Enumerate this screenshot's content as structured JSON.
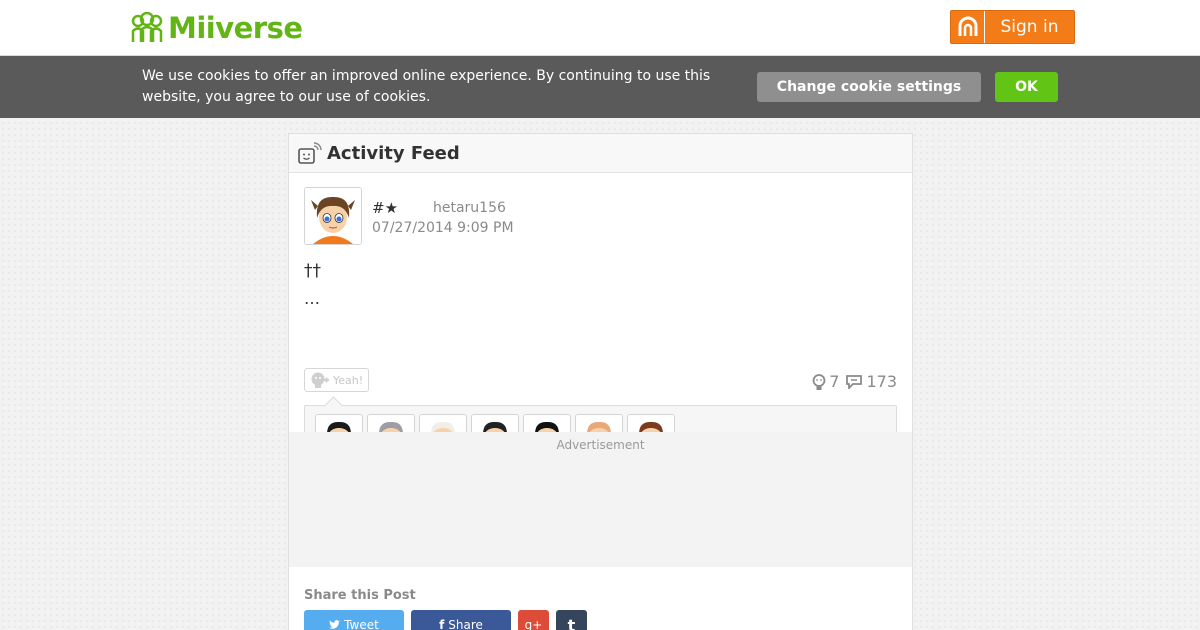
{
  "header": {
    "logo_text": "Miiverse",
    "signin_label": "Sign in"
  },
  "cookie": {
    "message": "We use cookies to offer an improved online experience. By continuing to use this website, you agree to our use of cookies.",
    "settings_label": "Change cookie settings",
    "ok_label": "OK"
  },
  "feed": {
    "title": "Activity Feed"
  },
  "post": {
    "screen_name": "#★",
    "user_id": "hetaru156",
    "timestamp": "07/27/2014 9:09 PM",
    "body_line1": "††",
    "body_line2": "…",
    "yeah_label": "Yeah!",
    "empathy_count": "7",
    "reply_count": "173"
  },
  "yeah_users": [
    {
      "hair": "#1a1a1a",
      "shirt": "#2e9a3f",
      "glasses": "sunglasses"
    },
    {
      "hair": "#9d9da5",
      "shirt": "#303030",
      "glasses": "none"
    },
    {
      "hair": "#f2ede6",
      "shirt": "#2f66c8",
      "glasses": "none"
    },
    {
      "hair": "#222222",
      "shirt": "#2a2a2a",
      "glasses": "glasses"
    },
    {
      "hair": "#111111",
      "shirt": "#d63131",
      "glasses": "red-glasses"
    },
    {
      "hair": "#e8a878",
      "shirt": "#222222",
      "glasses": "sunglasses"
    },
    {
      "hair": "#7a3b1f",
      "shirt": "#e86d9e",
      "glasses": "none"
    }
  ],
  "ad": {
    "label": "Advertisement"
  },
  "share": {
    "title": "Share this Post",
    "tweet_label": "Tweet",
    "facebook_label": "Share"
  },
  "colors": {
    "brand_green": "#62b514",
    "signin_orange": "#f47c18",
    "ok_green": "#62c414",
    "twitter": "#55acee",
    "facebook": "#3b5998",
    "gplus": "#dd4b39",
    "tumblr": "#35465c"
  }
}
